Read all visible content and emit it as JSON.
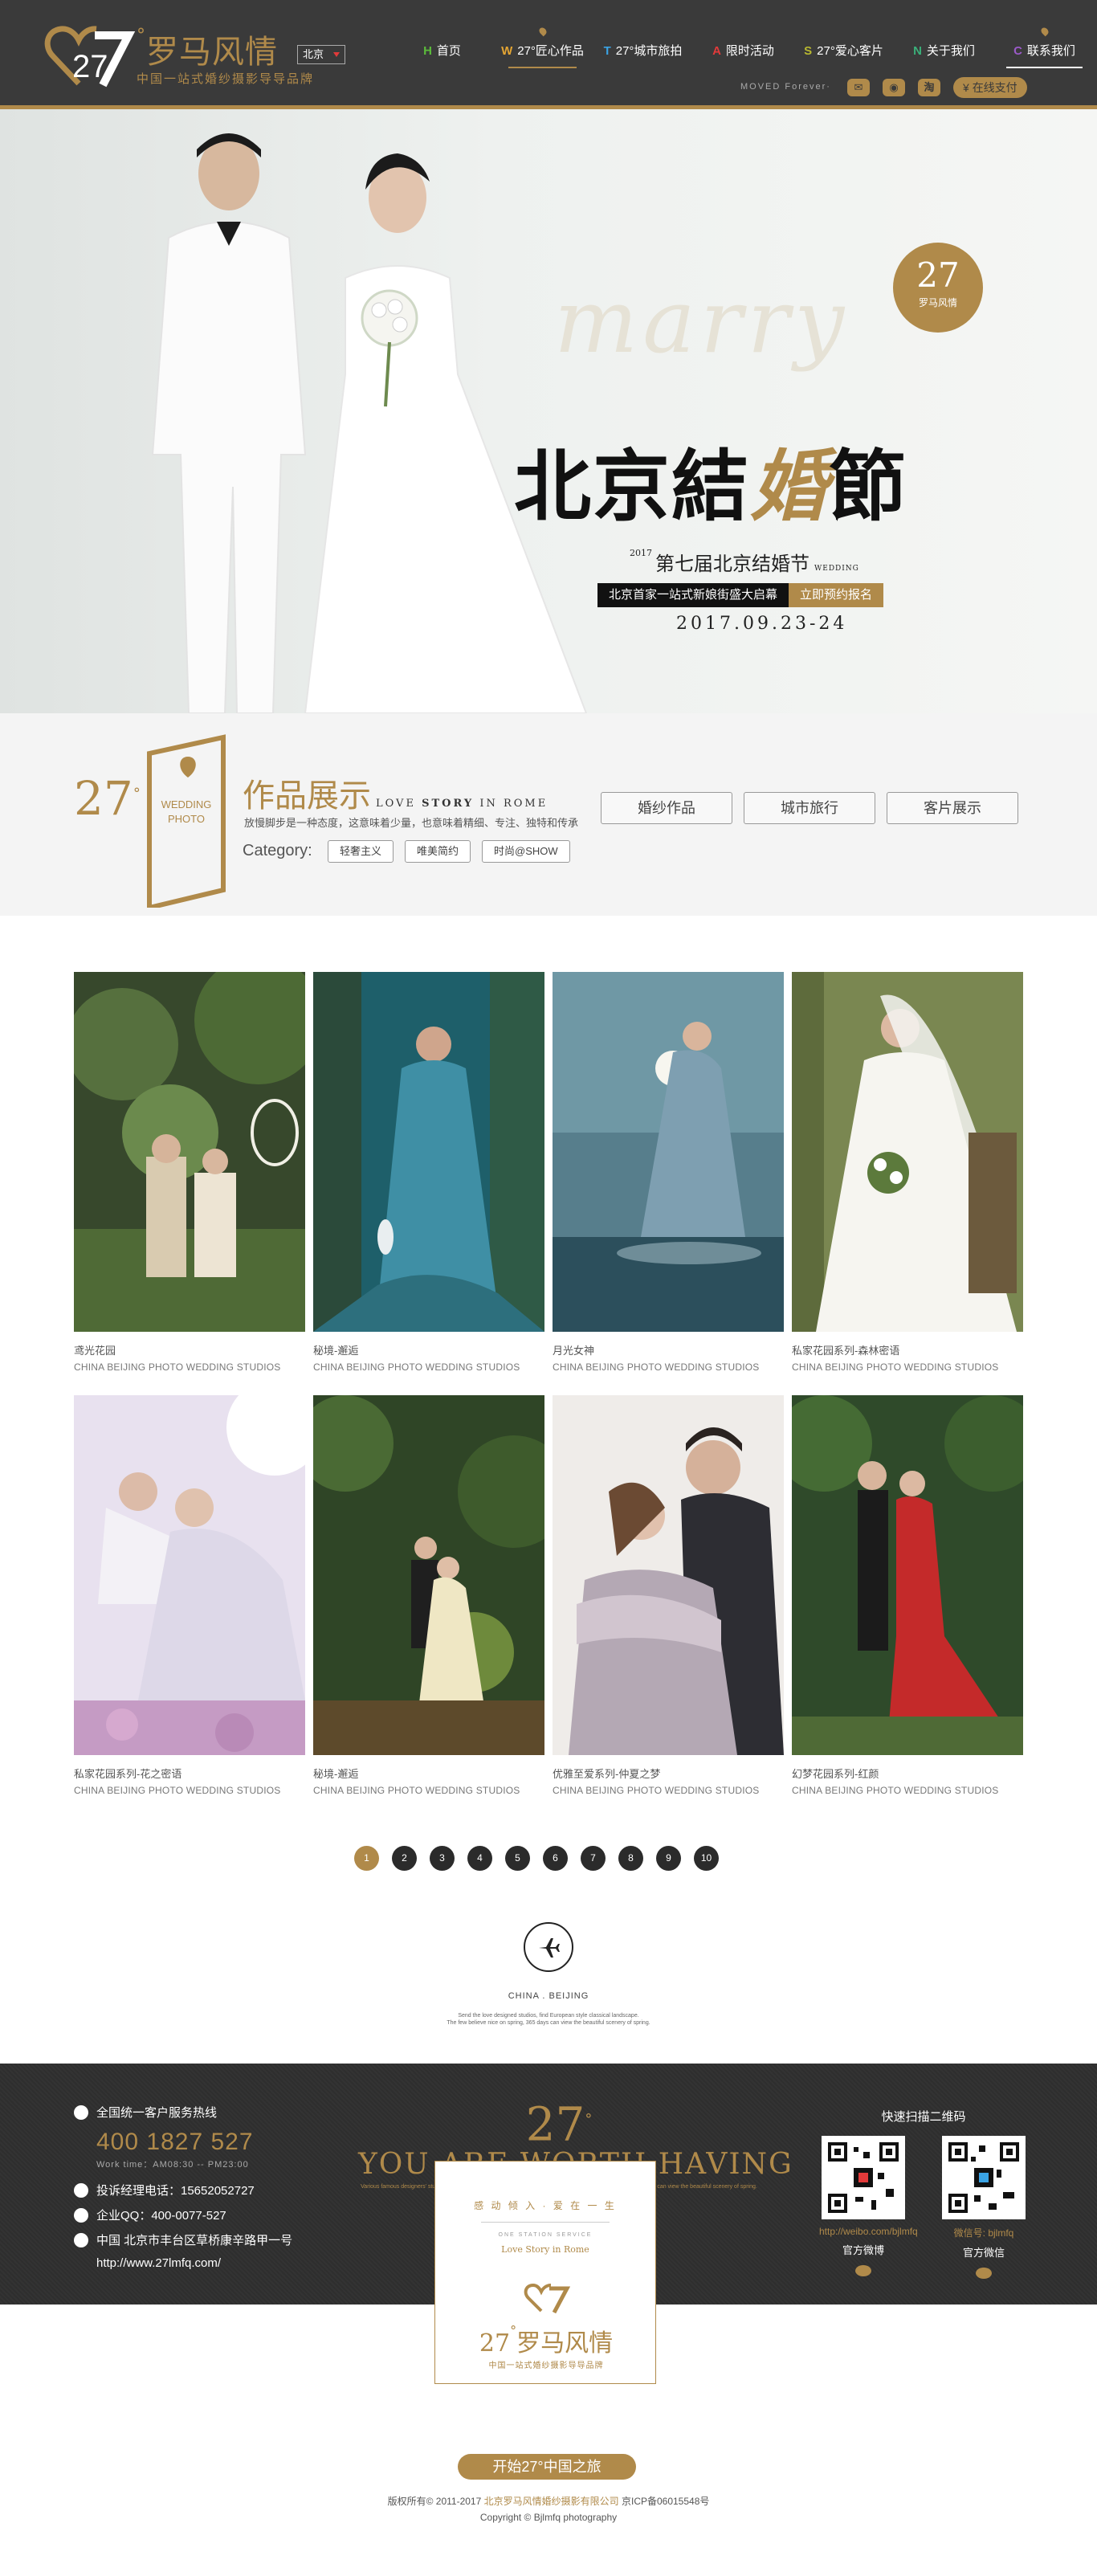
{
  "brand": {
    "number": "27",
    "name": "罗马风情",
    "slogan": "中国一站式婚纱摄影导导品牌"
  },
  "city": "北京",
  "nav": [
    {
      "letter": "H",
      "label": "首页",
      "color": "#5bbb3a"
    },
    {
      "letter": "W",
      "label": "27°匠心作品",
      "color": "#e4a533"
    },
    {
      "letter": "T",
      "label": "27°城市旅拍",
      "color": "#3aa3e4"
    },
    {
      "letter": "A",
      "label": "限时活动",
      "color": "#e23a3a"
    },
    {
      "letter": "S",
      "label": "27°爱心客片",
      "color": "#b8b830"
    },
    {
      "letter": "N",
      "label": "关于我们",
      "color": "#3ab07a"
    },
    {
      "letter": "C",
      "label": "联系我们",
      "color": "#9a5ac8"
    }
  ],
  "tagline": "MOVED Forever·",
  "social": {
    "weixin": "weixin-icon",
    "weibo": "weibo-icon",
    "taobao": "淘",
    "pay_label": "在线支付"
  },
  "banner": {
    "marry": "marry",
    "badge_number": "27",
    "badge_text": "罗马风情",
    "title_a": "北京結",
    "title_b": "婚",
    "title_c": "節",
    "sub_year": "2017",
    "subtitle": "第七届北京结婚节",
    "sub_en": "WEDDING",
    "strip_left": "北京首家一站式新娘街盛大启幕",
    "strip_right": "立即预约报名",
    "date": "2017.09.23-24"
  },
  "works": {
    "logo_number": "27",
    "door_text_1": "WEDDING",
    "door_text_2": "PHOTO",
    "heading": "作品展示",
    "heading_en_1": "LOVE",
    "heading_en_2": "STORY",
    "heading_en_3": "IN ROME",
    "desc": "放慢脚步是一种态度，这意味着少量，也意味着精细、专注、独特和传承",
    "category_label": "Category:",
    "categories": [
      "轻奢主义",
      "唯美简约",
      "时尚@SHOW"
    ],
    "tabs": [
      "婚纱作品",
      "城市旅行",
      "客片展示"
    ]
  },
  "photos": [
    {
      "caption": "鸢光花园",
      "sub": "CHINA BEIJING PHOTO WEDDING STUDIOS"
    },
    {
      "caption": "秘境-邂逅",
      "sub": "CHINA BEIJING PHOTO WEDDING STUDIOS"
    },
    {
      "caption": "月光女神",
      "sub": "CHINA BEIJING PHOTO WEDDING STUDIOS"
    },
    {
      "caption": "私家花园系列-森林密语",
      "sub": "CHINA BEIJING PHOTO WEDDING STUDIOS"
    },
    {
      "caption": "私家花园系列-花之密语",
      "sub": "CHINA BEIJING PHOTO WEDDING STUDIOS"
    },
    {
      "caption": "秘境-邂逅",
      "sub": "CHINA BEIJING PHOTO WEDDING STUDIOS"
    },
    {
      "caption": "优雅至爱系列-仲夏之梦",
      "sub": "CHINA BEIJING PHOTO WEDDING STUDIOS"
    },
    {
      "caption": "幻梦花园系列-红颜",
      "sub": "CHINA BEIJING PHOTO WEDDING STUDIOS"
    }
  ],
  "pages": [
    "1",
    "2",
    "3",
    "4",
    "5",
    "6",
    "7",
    "8",
    "9",
    "10"
  ],
  "travel": {
    "icon": "airplane-icon",
    "line1": "CHINA . BEIJING",
    "line2": "Send the love designed studios, find European style classical landscape.",
    "line3": "The few believe nice on spring, 365 days can view the beautiful scenery of spring."
  },
  "footer": {
    "hotline_label": "全国统一客户服务热线",
    "phone": "400 1827 527",
    "hours": "Work time：AM08:30 -- PM23:00",
    "complaint": "投诉经理电话：15652052727",
    "qq": "企业QQ：400-0077-527",
    "address": "中国 北京市丰台区草桥康辛路甲一号",
    "website": "http://www.27lmfq.com/",
    "center_number": "27",
    "worth": "YOU ARE WORTH HAVING",
    "worth_small": "Various famous designers' studios, find European style classical landscape. The few scenery used on spring, 365 days can view the beautiful scenery of spring.",
    "qr_title": "快速扫描二维码",
    "weibo_url": "http://weibo.com/bjlmfq",
    "weibo_label": "官方微博",
    "wechat_id": "微信号: bjlmfq",
    "wechat_label": "官方微信"
  },
  "card": {
    "line1": "感 动 倾 入  · 爱 在 一 生",
    "line2": "ONE STATION SERVICE",
    "line3": "Love Story in Rome",
    "logo_number": "27",
    "logo_name": "罗马风情",
    "slogan": "中国一站式婚纱摄影导导品牌"
  },
  "bottom": {
    "start": "开始27°中国之旅",
    "copy_prefix": "版权所有© 2011-2017",
    "copy_company": "北京罗马风情婚纱摄影有限公司",
    "copy_icp": "京ICP备06015548号",
    "copy_en": "Copyright © Bjlmfq photography"
  }
}
